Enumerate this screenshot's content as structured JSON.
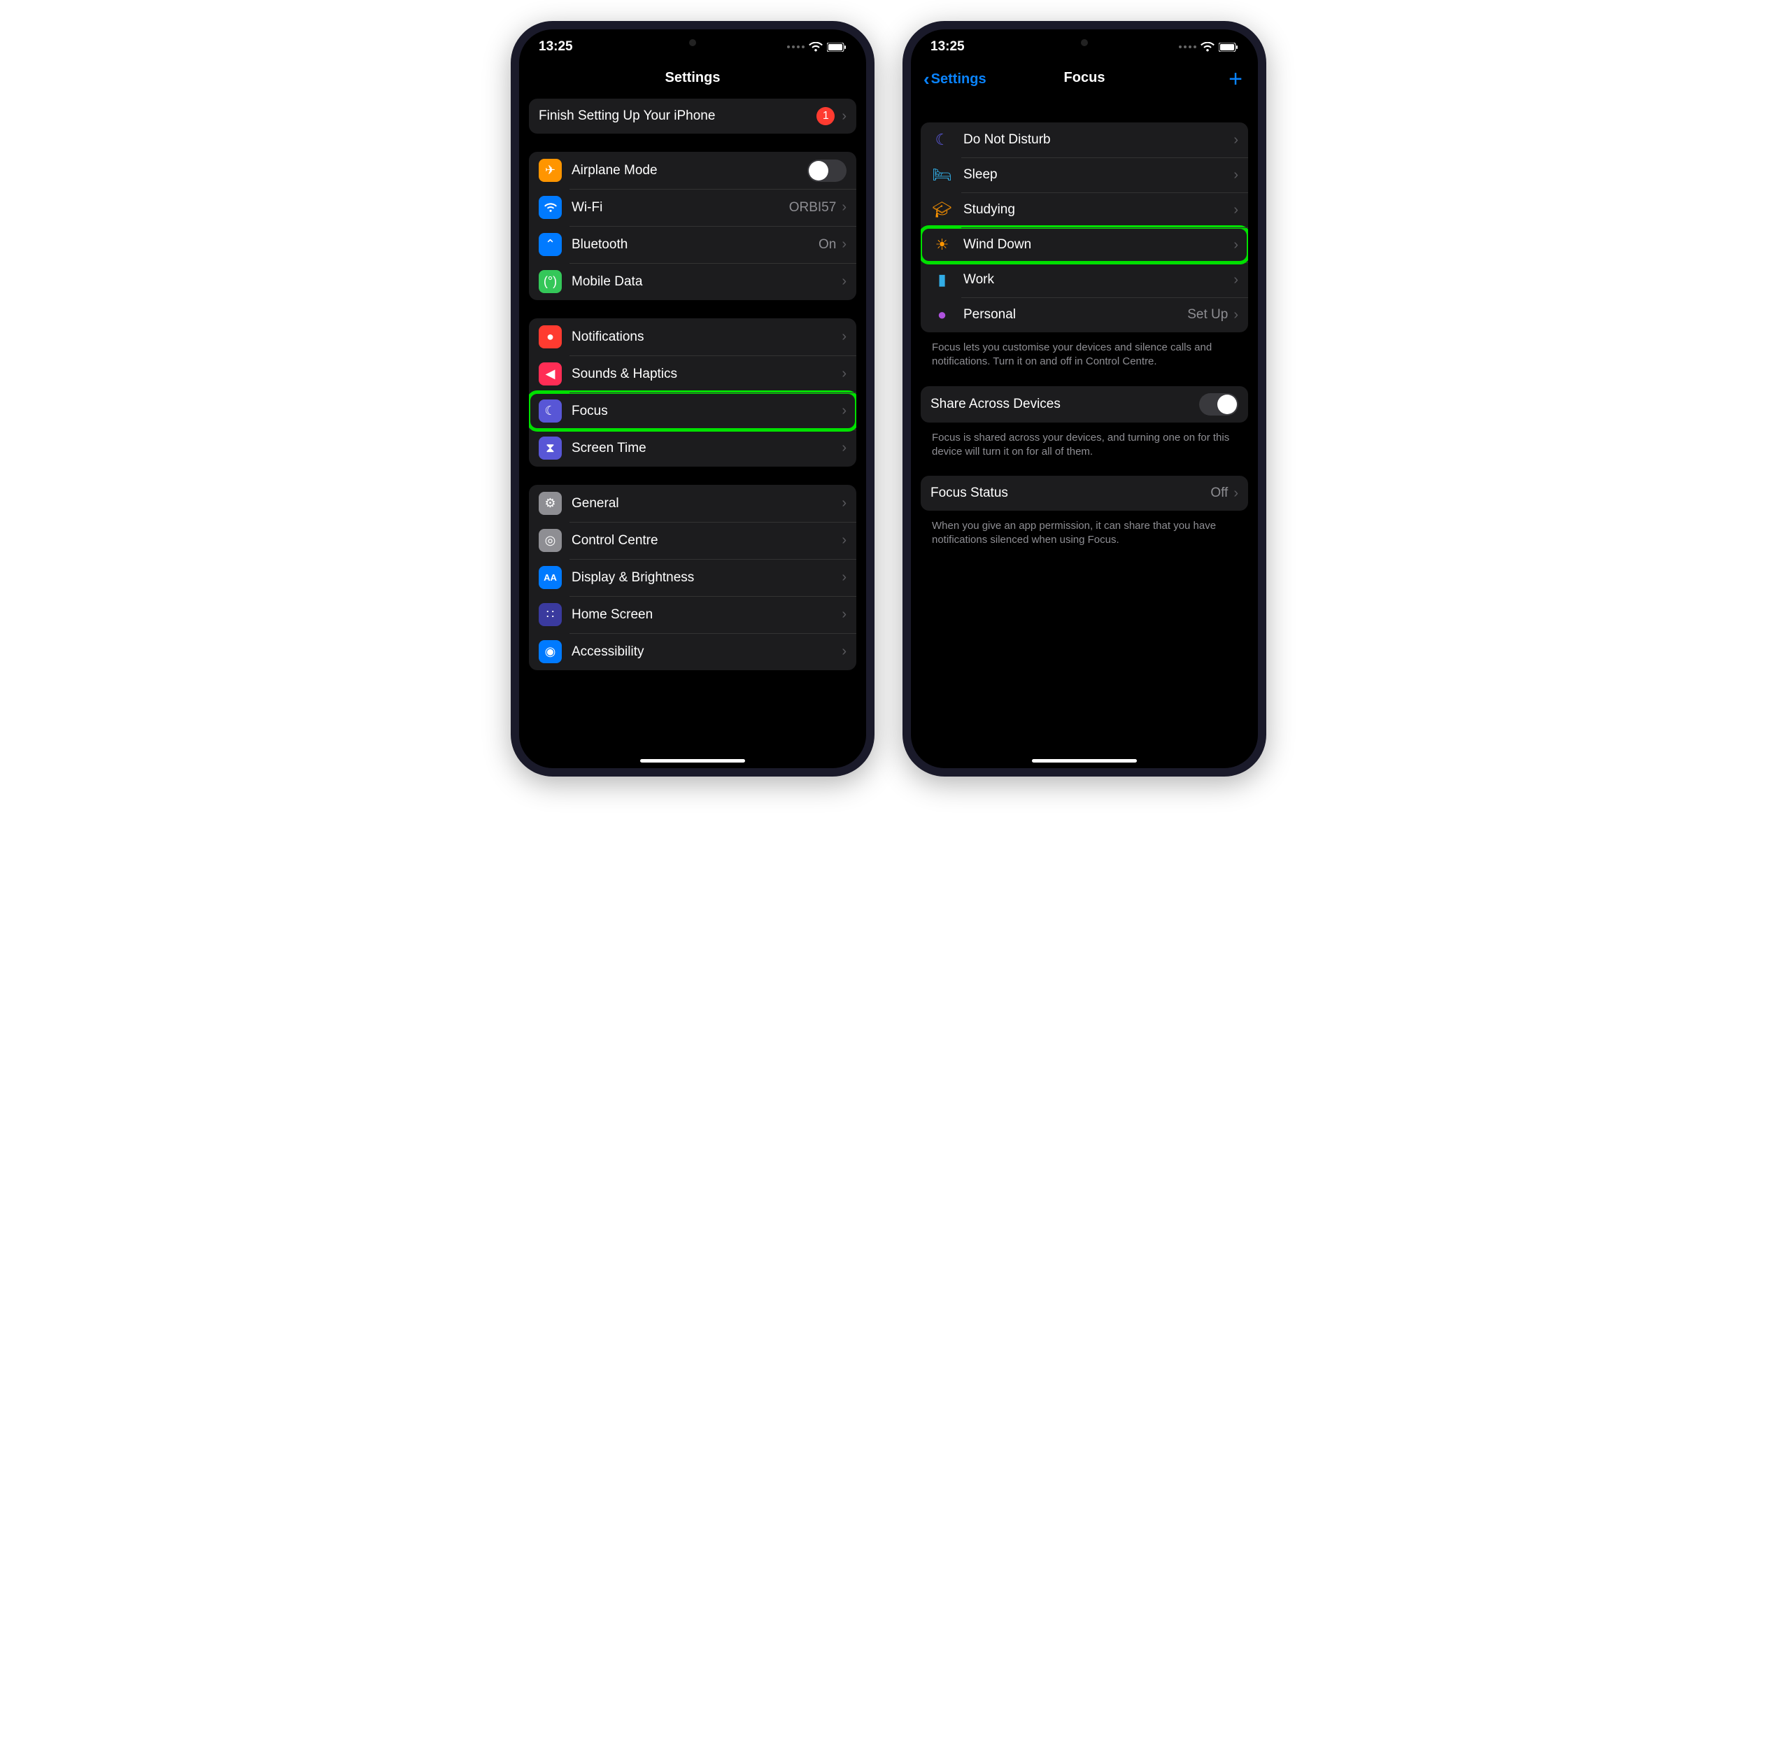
{
  "status": {
    "time": "13:25"
  },
  "left": {
    "title": "Settings",
    "setup": {
      "label": "Finish Setting Up Your iPhone",
      "badge": "1"
    },
    "network": {
      "airplane": "Airplane Mode",
      "wifi": "Wi-Fi",
      "wifi_value": "ORBI57",
      "bluetooth": "Bluetooth",
      "bluetooth_value": "On",
      "mobile": "Mobile Data"
    },
    "focus_group": {
      "notifications": "Notifications",
      "sounds": "Sounds & Haptics",
      "focus": "Focus",
      "screentime": "Screen Time"
    },
    "general_group": {
      "general": "General",
      "control": "Control Centre",
      "display": "Display & Brightness",
      "home": "Home Screen",
      "accessibility": "Accessibility"
    }
  },
  "right": {
    "back": "Settings",
    "title": "Focus",
    "modes": {
      "dnd": "Do Not Disturb",
      "sleep": "Sleep",
      "studying": "Studying",
      "winddown": "Wind Down",
      "work": "Work",
      "personal": "Personal",
      "personal_value": "Set Up"
    },
    "footer1": "Focus lets you customise your devices and silence calls and notifications. Turn it on and off in Control Centre.",
    "share": {
      "label": "Share Across Devices"
    },
    "footer2": "Focus is shared across your devices, and turning one on for this device will turn it on for all of them.",
    "status_row": {
      "label": "Focus Status",
      "value": "Off"
    },
    "footer3": "When you give an app permission, it can share that you have notifications silenced when using Focus."
  },
  "colors": {
    "orange": "#ff9500",
    "blue": "#007aff",
    "green": "#34c759",
    "red": "#ff3b30",
    "pink": "#ff2d55",
    "indigo": "#5856d6",
    "gray": "#8e8e93",
    "cyan": "#32ade6",
    "purple": "#af52de"
  }
}
